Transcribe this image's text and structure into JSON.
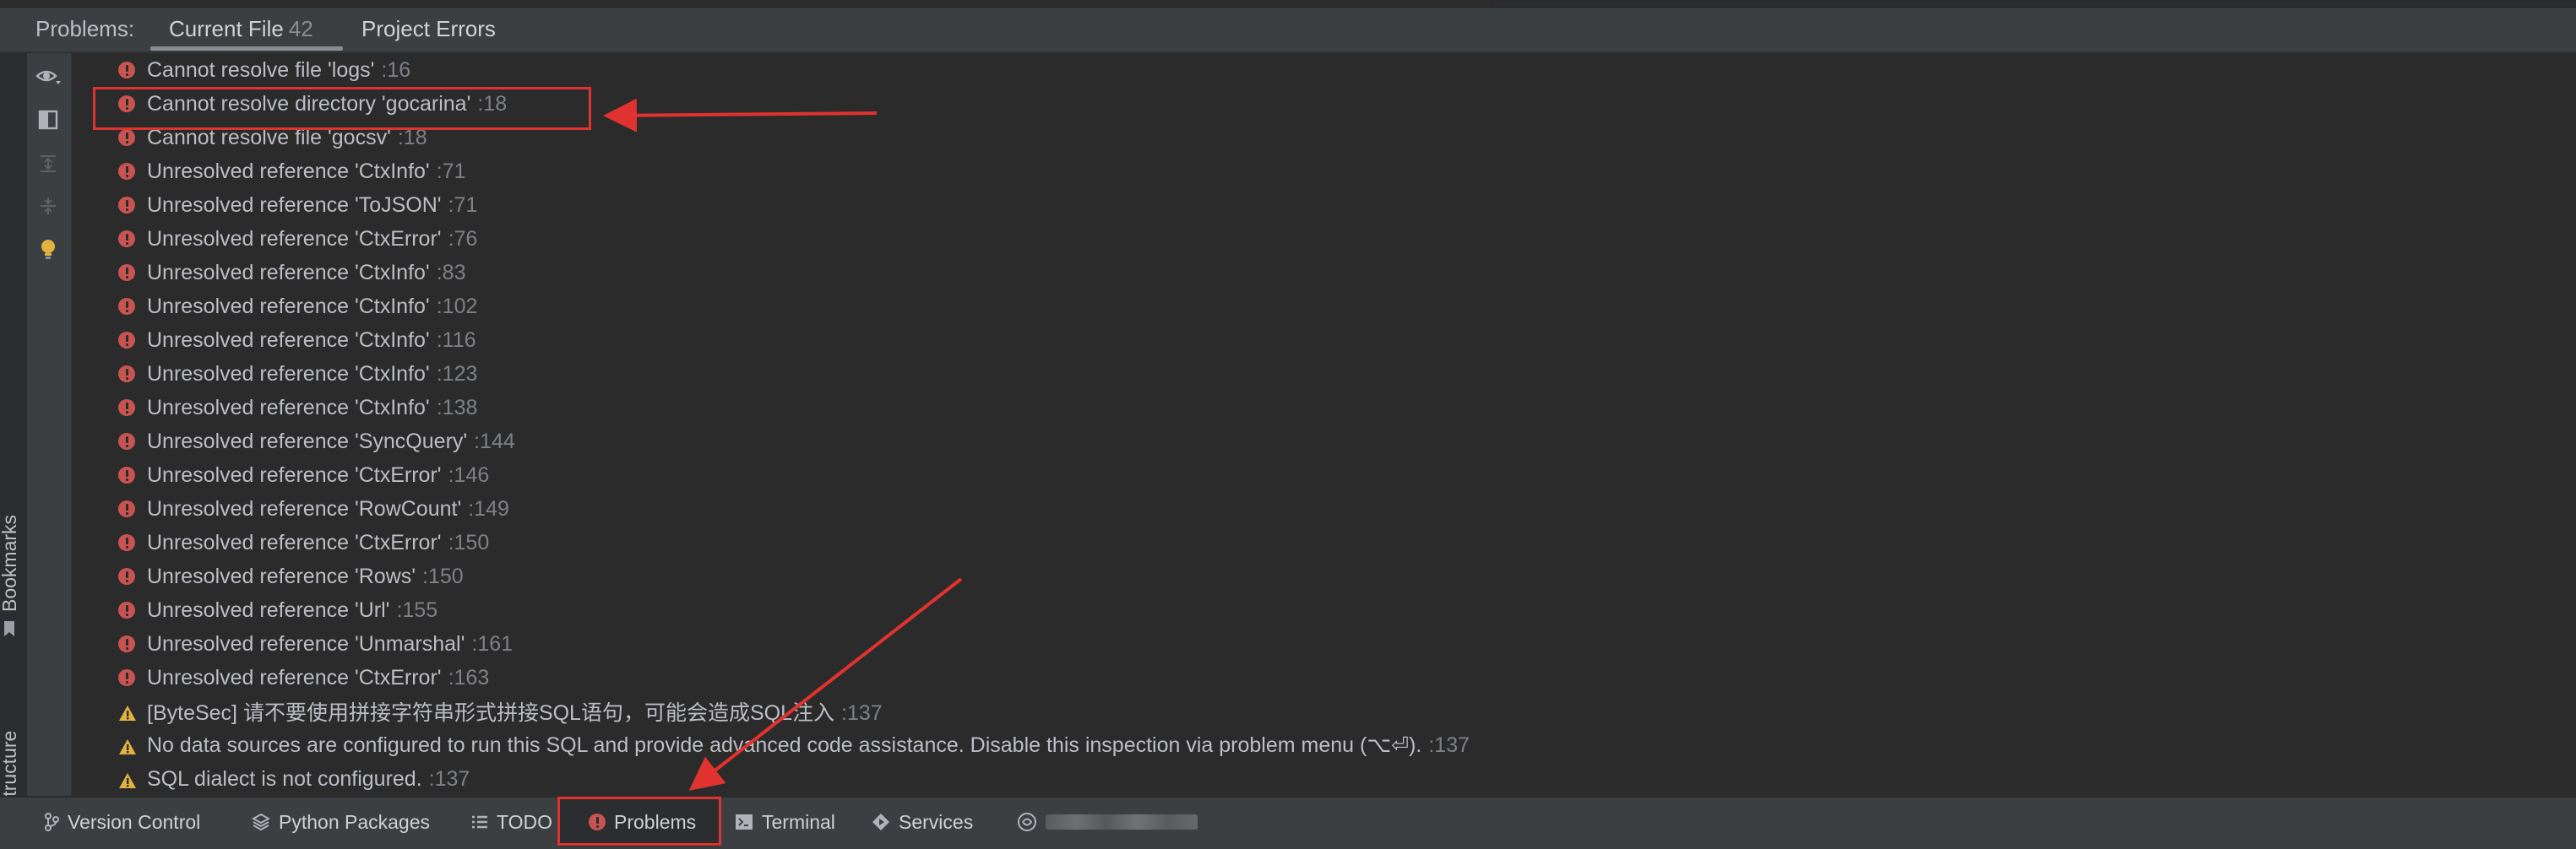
{
  "header": {
    "title": "Problems:",
    "tabs": [
      {
        "label": "Current File",
        "count": "42"
      },
      {
        "label": "Project Errors"
      }
    ]
  },
  "sidebar": {
    "bookmarks_label": "Bookmarks",
    "structure_label": "Structure"
  },
  "problems": [
    {
      "severity": "error",
      "message": "Cannot resolve file 'logs'",
      "line": ":16"
    },
    {
      "severity": "error",
      "message": "Cannot resolve directory 'gocarina'",
      "line": ":18"
    },
    {
      "severity": "error",
      "message": "Cannot resolve file 'gocsv'",
      "line": ":18"
    },
    {
      "severity": "error",
      "message": "Unresolved reference 'CtxInfo'",
      "line": ":71"
    },
    {
      "severity": "error",
      "message": "Unresolved reference 'ToJSON'",
      "line": ":71"
    },
    {
      "severity": "error",
      "message": "Unresolved reference 'CtxError'",
      "line": ":76"
    },
    {
      "severity": "error",
      "message": "Unresolved reference 'CtxInfo'",
      "line": ":83"
    },
    {
      "severity": "error",
      "message": "Unresolved reference 'CtxInfo'",
      "line": ":102"
    },
    {
      "severity": "error",
      "message": "Unresolved reference 'CtxInfo'",
      "line": ":116"
    },
    {
      "severity": "error",
      "message": "Unresolved reference 'CtxInfo'",
      "line": ":123"
    },
    {
      "severity": "error",
      "message": "Unresolved reference 'CtxInfo'",
      "line": ":138"
    },
    {
      "severity": "error",
      "message": "Unresolved reference 'SyncQuery'",
      "line": ":144"
    },
    {
      "severity": "error",
      "message": "Unresolved reference 'CtxError'",
      "line": ":146"
    },
    {
      "severity": "error",
      "message": "Unresolved reference 'RowCount'",
      "line": ":149"
    },
    {
      "severity": "error",
      "message": "Unresolved reference 'CtxError'",
      "line": ":150"
    },
    {
      "severity": "error",
      "message": "Unresolved reference 'Rows'",
      "line": ":150"
    },
    {
      "severity": "error",
      "message": "Unresolved reference 'Url'",
      "line": ":155"
    },
    {
      "severity": "error",
      "message": "Unresolved reference 'Unmarshal'",
      "line": ":161"
    },
    {
      "severity": "error",
      "message": "Unresolved reference 'CtxError'",
      "line": ":163"
    },
    {
      "severity": "warning",
      "message": "[ByteSec] 请不要使用拼接字符串形式拼接SQL语句，可能会造成SQL注入",
      "line": ":137"
    },
    {
      "severity": "warning",
      "message": "No data sources are configured to run this SQL and provide advanced code assistance. Disable this inspection via problem menu (⌥⏎).",
      "line": ":137"
    },
    {
      "severity": "warning",
      "message": "SQL dialect is not configured.",
      "line": ":137"
    }
  ],
  "bottom_tabs": [
    {
      "label": "Version Control",
      "icon": "branch-icon"
    },
    {
      "label": "Python Packages",
      "icon": "layers-icon"
    },
    {
      "label": "TODO",
      "icon": "list-icon"
    },
    {
      "label": "Problems",
      "icon": "error-icon",
      "active": true
    },
    {
      "label": "Terminal",
      "icon": "terminal-icon"
    },
    {
      "label": "Services",
      "icon": "play-icon"
    }
  ],
  "colors": {
    "error": "#c75450",
    "warning": "#e0b341",
    "highlight": "#e0322e"
  }
}
